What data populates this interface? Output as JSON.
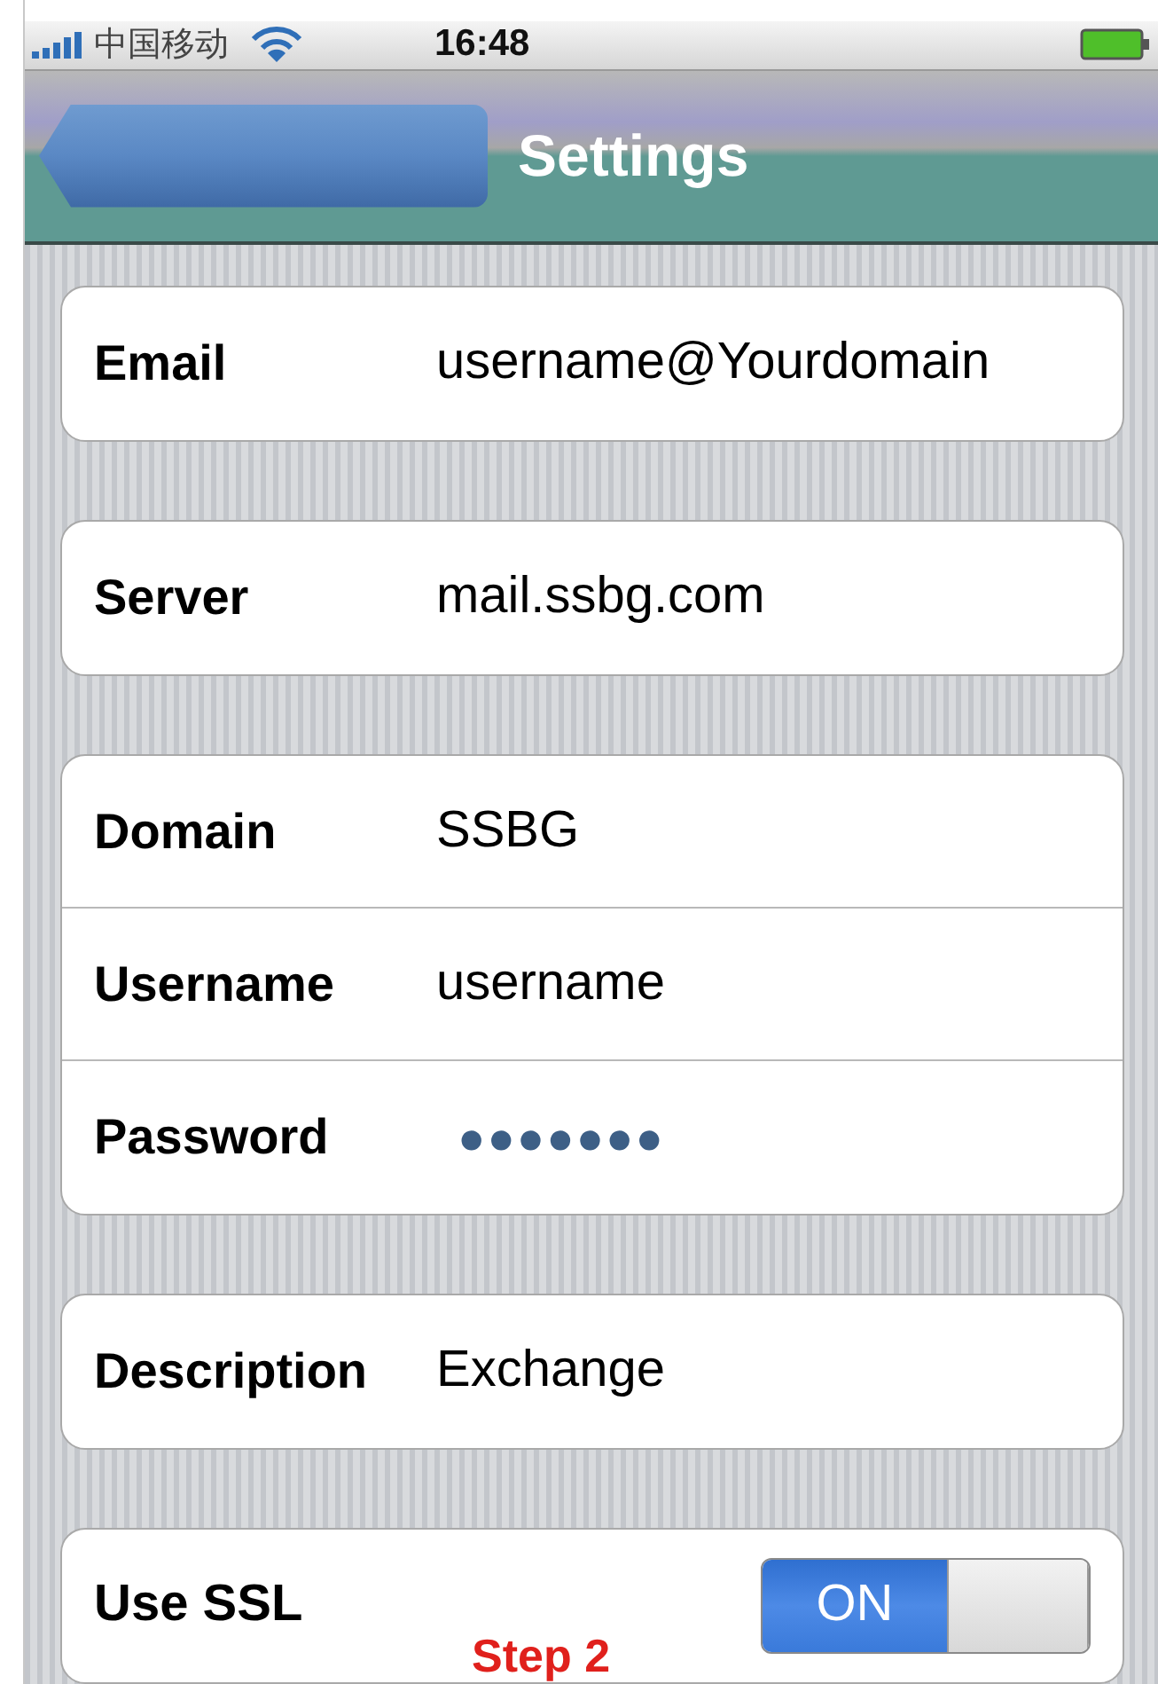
{
  "status_bar": {
    "carrier": "中国移动",
    "time": "16:48"
  },
  "nav_bar": {
    "title": "Settings"
  },
  "groups": [
    {
      "rows": [
        {
          "kind": "field",
          "label": "Email",
          "value": "username@Yourdomain"
        }
      ]
    },
    {
      "rows": [
        {
          "kind": "field",
          "label": "Server",
          "value": "mail.ssbg.com"
        }
      ]
    },
    {
      "rows": [
        {
          "kind": "field",
          "label": "Domain",
          "value": "SSBG"
        },
        {
          "kind": "field",
          "label": "Username",
          "value": "username"
        },
        {
          "kind": "password",
          "label": "Password",
          "value": "●●●●●●●"
        }
      ]
    },
    {
      "rows": [
        {
          "kind": "field",
          "label": "Description",
          "value": "Exchange"
        }
      ]
    },
    {
      "rows": [
        {
          "kind": "switch",
          "label": "Use SSL",
          "on": true,
          "state_label": "ON"
        }
      ]
    }
  ],
  "annotation": "Step 2"
}
